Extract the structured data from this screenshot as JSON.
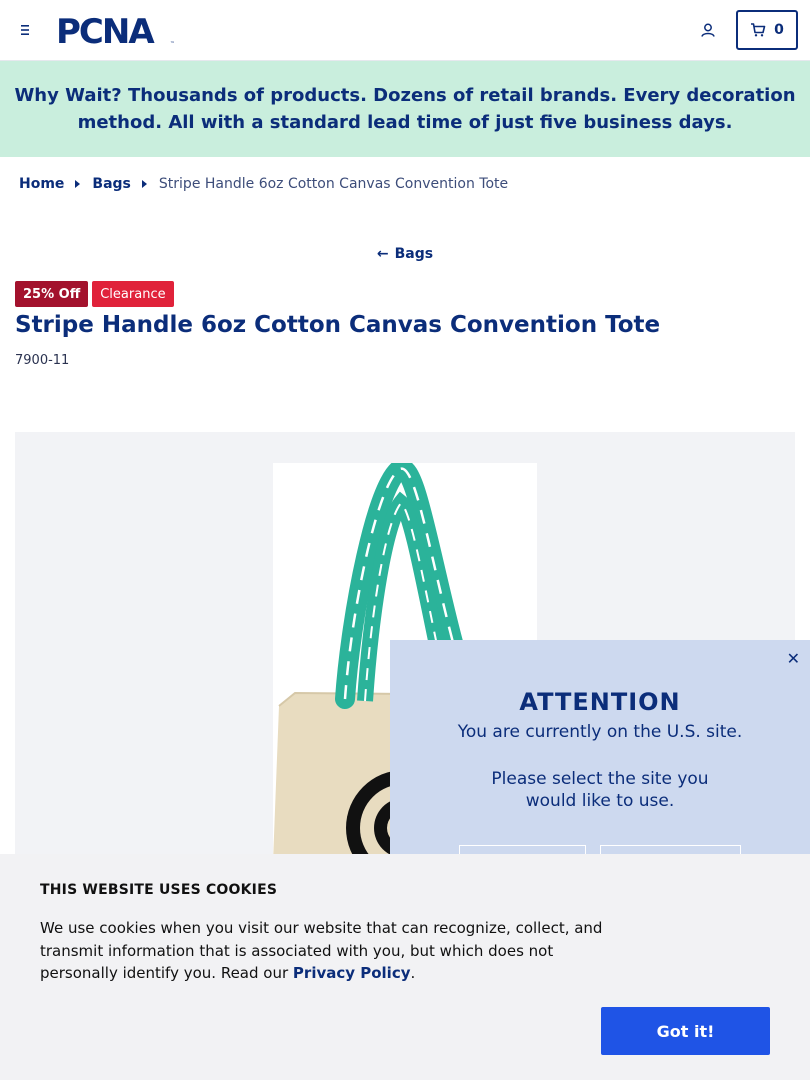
{
  "header": {
    "logo_text": "PCNA",
    "cart_count": "0",
    "icons": [
      "hamburger-menu-icon",
      "account-icon",
      "cart-icon"
    ]
  },
  "promo": {
    "lead": "Why Wait?",
    "text": "Thousands of products. Dozens of retail brands. Every decoration method. All with a standard lead time of just five business days."
  },
  "breadcrumb": {
    "items": [
      "Home",
      "Bags"
    ],
    "current": "Stripe Handle 6oz Cotton Canvas Convention Tote"
  },
  "back_link": {
    "label": "Bags"
  },
  "product": {
    "badges": [
      "25% Off",
      "Clearance"
    ],
    "title": "Stripe Handle 6oz Cotton Canvas Convention Tote",
    "sku": "7900-11"
  },
  "attention": {
    "title": "ATTENTION",
    "current_site": "You are currently on the U.S. site.",
    "select_site": "Please select the site you would like to use.",
    "close_symbol": "✕"
  },
  "cookies": {
    "heading": "THIS WEBSITE USES COOKIES",
    "text": "We use cookies when you visit our website that can recognize, collect, and transmit information that is associated with you, but which does not personally identify you. Read our",
    "link": "Privacy Policy",
    "period": ".",
    "button": "Got it!"
  },
  "colors": {
    "brand_navy": "#0b2d7a",
    "promo_bg": "#c9eedd",
    "discount_badge": "#a3122d",
    "clearance_badge": "#e0223a",
    "modal_bg": "#cdd9ef",
    "cta_blue": "#1f54e6"
  }
}
